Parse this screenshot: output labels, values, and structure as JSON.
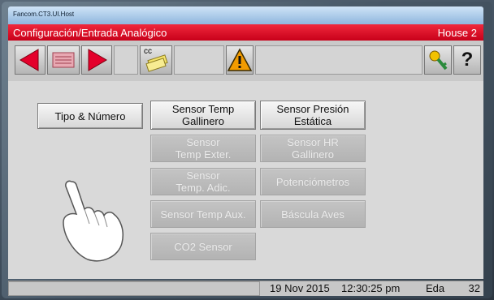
{
  "host": {
    "title": "Fancom.CT3.UI.Host"
  },
  "header": {
    "title": "Configuración/Entrada Analógico",
    "house": "House 2"
  },
  "toolbar": {
    "back_icon": "left-arrow-icon",
    "list_icon": "list-icon",
    "forward_icon": "right-arrow-icon",
    "cc_label": "cc",
    "warning_icon": "warning-icon",
    "key_icon": "key-icon",
    "help_label": "?"
  },
  "buttons": {
    "tipo_numero": "Tipo & Número",
    "sensor_temp_gallinero": "Sensor Temp\nGallinero",
    "sensor_presion_estatica": "Sensor Presión\nEstática",
    "sensor_temp_exter": "Sensor\nTemp Exter.",
    "sensor_hr_gallinero": "Sensor HR\nGallinero",
    "sensor_temp_adic": "Sensor\nTemp. Adic.",
    "potenciometros": "Potenciómetros",
    "sensor_temp_aux": "Sensor Temp Aux.",
    "bascula_aves": "Báscula Aves",
    "co2_sensor": "CO2 Sensor"
  },
  "status": {
    "date": "19 Nov 2015",
    "time": "12:30:25 pm",
    "user": "Eda",
    "number": "32"
  },
  "colors": {
    "title_red": "#d6001c",
    "nav_red": "#e4002b",
    "warning_orange": "#f29b00"
  }
}
